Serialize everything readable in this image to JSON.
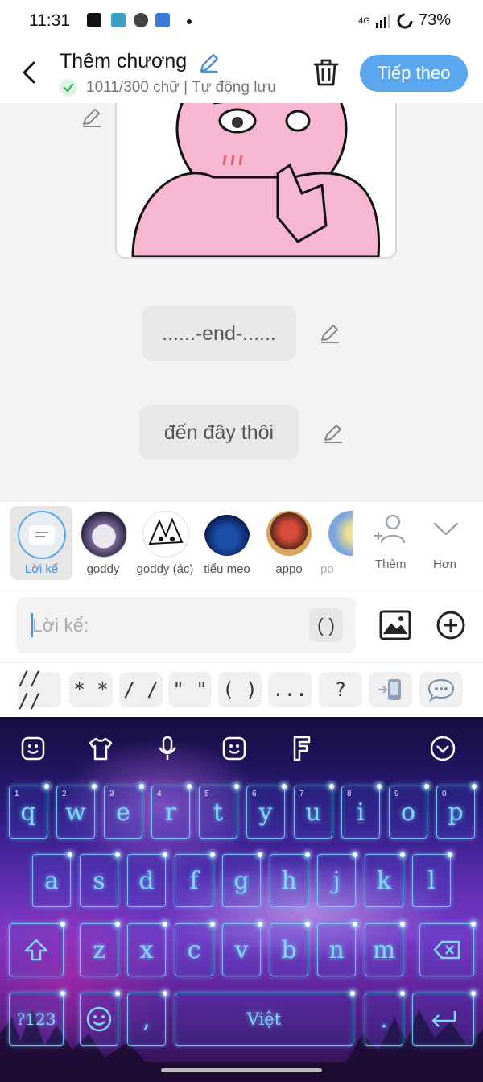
{
  "status": {
    "time": "11:31",
    "network": "4G",
    "battery": "73%"
  },
  "header": {
    "title": "Thêm chương",
    "subtitle": "1011/300 chữ | Tự động lưu",
    "next_label": "Tiếp theo"
  },
  "content": {
    "bubbles": [
      "......-end-......",
      "đến đây thôi"
    ]
  },
  "characters": {
    "narrator": "Lời kể",
    "items": [
      "goddy",
      "goddy (ác)",
      "tiểu meo",
      "appo",
      "po"
    ],
    "add_label": "Thêm",
    "more_label": "Hơn"
  },
  "input": {
    "placeholder": "Lời kể:",
    "paren": "( )"
  },
  "snippets": [
    "// //",
    "* *",
    "/ /",
    "\" \"",
    "( )",
    "...",
    "?"
  ],
  "keyboard": {
    "row1": [
      "q",
      "w",
      "e",
      "r",
      "t",
      "y",
      "u",
      "i",
      "o",
      "p"
    ],
    "row1_hints": [
      "1",
      "2",
      "3",
      "4",
      "5",
      "6",
      "7",
      "8",
      "9",
      "0"
    ],
    "row2": [
      "a",
      "s",
      "d",
      "f",
      "g",
      "h",
      "j",
      "k",
      "l"
    ],
    "row3": [
      "z",
      "x",
      "c",
      "v",
      "b",
      "n",
      "m"
    ],
    "symbols_label": "?123",
    "comma": ",",
    "space_label": "Việt",
    "period": "."
  },
  "colors": {
    "accent": "#5aa6ef",
    "check": "#3bb85c"
  }
}
